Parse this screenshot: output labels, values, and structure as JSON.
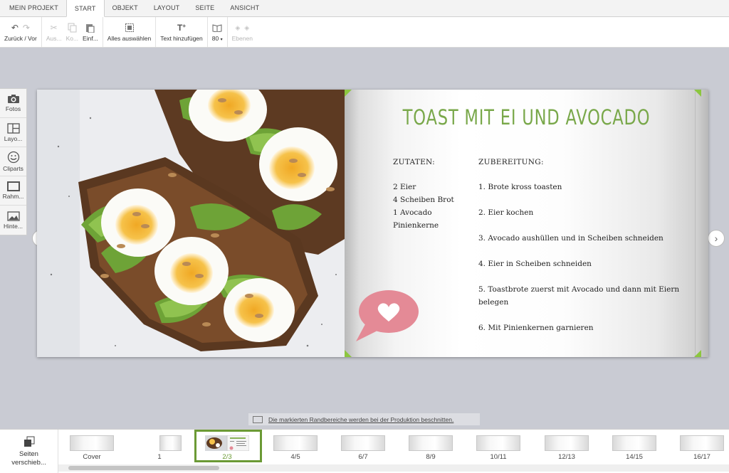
{
  "tabs": [
    {
      "label": "MEIN PROJEKT"
    },
    {
      "label": "START",
      "active": true
    },
    {
      "label": "OBJEKT"
    },
    {
      "label": "LAYOUT"
    },
    {
      "label": "SEITE"
    },
    {
      "label": "ANSICHT"
    }
  ],
  "toolbar": {
    "undo_redo": "Zurück / Vor",
    "cut": "Aus...",
    "copy": "Ko...",
    "paste": "Einf...",
    "select_all": "Alles auswählen",
    "add_text": "Text hinzufügen",
    "zoom": "80",
    "layers": "Ebenen"
  },
  "left_tools": [
    "Fotos",
    "Layo...",
    "Cliparts",
    "Rahm...",
    "Hinte..."
  ],
  "recipe": {
    "title": "TOAST MIT EI UND AVOCADO",
    "ingredients_heading": "ZUTATEN:",
    "ingredients": [
      "2 Eier",
      "4 Scheiben Brot",
      "1 Avocado",
      "Pinienkerne"
    ],
    "steps_heading": "ZUBEREITUNG:",
    "steps": [
      "1. Brote kross toasten",
      "2. Eier kochen",
      "3. Avocado aushüllen und in Scheiben schneiden",
      "4. Eier in Scheiben schneiden",
      "5. Toastbrote zuerst mit Avocado und dann mit Eiern belegen",
      "6. Mit Pinienkernen garnieren"
    ]
  },
  "notice": "Die markierten Randbereiche werden bei der Produktion beschnitten.",
  "page_strip": {
    "shift_label": "Seiten verschieb...",
    "pages": [
      "Cover",
      "1",
      "2/3",
      "4/5",
      "6/7",
      "8/9",
      "10/11",
      "12/13",
      "14/15",
      "16/17"
    ],
    "selected": "2/3"
  },
  "colors": {
    "accent": "#6b9a35",
    "title_green": "#79a84a",
    "heart_pink": "#e48a96"
  }
}
